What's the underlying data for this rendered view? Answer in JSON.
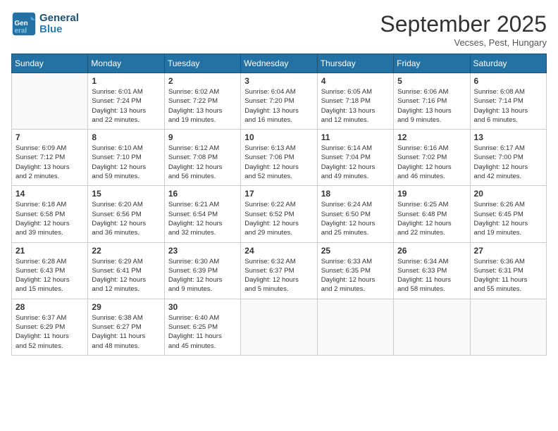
{
  "header": {
    "logo_line1": "General",
    "logo_line2": "Blue",
    "month": "September 2025",
    "location": "Vecses, Pest, Hungary"
  },
  "days_of_week": [
    "Sunday",
    "Monday",
    "Tuesday",
    "Wednesday",
    "Thursday",
    "Friday",
    "Saturday"
  ],
  "weeks": [
    [
      {
        "num": "",
        "info": ""
      },
      {
        "num": "1",
        "info": "Sunrise: 6:01 AM\nSunset: 7:24 PM\nDaylight: 13 hours\nand 22 minutes."
      },
      {
        "num": "2",
        "info": "Sunrise: 6:02 AM\nSunset: 7:22 PM\nDaylight: 13 hours\nand 19 minutes."
      },
      {
        "num": "3",
        "info": "Sunrise: 6:04 AM\nSunset: 7:20 PM\nDaylight: 13 hours\nand 16 minutes."
      },
      {
        "num": "4",
        "info": "Sunrise: 6:05 AM\nSunset: 7:18 PM\nDaylight: 13 hours\nand 12 minutes."
      },
      {
        "num": "5",
        "info": "Sunrise: 6:06 AM\nSunset: 7:16 PM\nDaylight: 13 hours\nand 9 minutes."
      },
      {
        "num": "6",
        "info": "Sunrise: 6:08 AM\nSunset: 7:14 PM\nDaylight: 13 hours\nand 6 minutes."
      }
    ],
    [
      {
        "num": "7",
        "info": "Sunrise: 6:09 AM\nSunset: 7:12 PM\nDaylight: 13 hours\nand 2 minutes."
      },
      {
        "num": "8",
        "info": "Sunrise: 6:10 AM\nSunset: 7:10 PM\nDaylight: 12 hours\nand 59 minutes."
      },
      {
        "num": "9",
        "info": "Sunrise: 6:12 AM\nSunset: 7:08 PM\nDaylight: 12 hours\nand 56 minutes."
      },
      {
        "num": "10",
        "info": "Sunrise: 6:13 AM\nSunset: 7:06 PM\nDaylight: 12 hours\nand 52 minutes."
      },
      {
        "num": "11",
        "info": "Sunrise: 6:14 AM\nSunset: 7:04 PM\nDaylight: 12 hours\nand 49 minutes."
      },
      {
        "num": "12",
        "info": "Sunrise: 6:16 AM\nSunset: 7:02 PM\nDaylight: 12 hours\nand 46 minutes."
      },
      {
        "num": "13",
        "info": "Sunrise: 6:17 AM\nSunset: 7:00 PM\nDaylight: 12 hours\nand 42 minutes."
      }
    ],
    [
      {
        "num": "14",
        "info": "Sunrise: 6:18 AM\nSunset: 6:58 PM\nDaylight: 12 hours\nand 39 minutes."
      },
      {
        "num": "15",
        "info": "Sunrise: 6:20 AM\nSunset: 6:56 PM\nDaylight: 12 hours\nand 36 minutes."
      },
      {
        "num": "16",
        "info": "Sunrise: 6:21 AM\nSunset: 6:54 PM\nDaylight: 12 hours\nand 32 minutes."
      },
      {
        "num": "17",
        "info": "Sunrise: 6:22 AM\nSunset: 6:52 PM\nDaylight: 12 hours\nand 29 minutes."
      },
      {
        "num": "18",
        "info": "Sunrise: 6:24 AM\nSunset: 6:50 PM\nDaylight: 12 hours\nand 25 minutes."
      },
      {
        "num": "19",
        "info": "Sunrise: 6:25 AM\nSunset: 6:48 PM\nDaylight: 12 hours\nand 22 minutes."
      },
      {
        "num": "20",
        "info": "Sunrise: 6:26 AM\nSunset: 6:45 PM\nDaylight: 12 hours\nand 19 minutes."
      }
    ],
    [
      {
        "num": "21",
        "info": "Sunrise: 6:28 AM\nSunset: 6:43 PM\nDaylight: 12 hours\nand 15 minutes."
      },
      {
        "num": "22",
        "info": "Sunrise: 6:29 AM\nSunset: 6:41 PM\nDaylight: 12 hours\nand 12 minutes."
      },
      {
        "num": "23",
        "info": "Sunrise: 6:30 AM\nSunset: 6:39 PM\nDaylight: 12 hours\nand 9 minutes."
      },
      {
        "num": "24",
        "info": "Sunrise: 6:32 AM\nSunset: 6:37 PM\nDaylight: 12 hours\nand 5 minutes."
      },
      {
        "num": "25",
        "info": "Sunrise: 6:33 AM\nSunset: 6:35 PM\nDaylight: 12 hours\nand 2 minutes."
      },
      {
        "num": "26",
        "info": "Sunrise: 6:34 AM\nSunset: 6:33 PM\nDaylight: 11 hours\nand 58 minutes."
      },
      {
        "num": "27",
        "info": "Sunrise: 6:36 AM\nSunset: 6:31 PM\nDaylight: 11 hours\nand 55 minutes."
      }
    ],
    [
      {
        "num": "28",
        "info": "Sunrise: 6:37 AM\nSunset: 6:29 PM\nDaylight: 11 hours\nand 52 minutes."
      },
      {
        "num": "29",
        "info": "Sunrise: 6:38 AM\nSunset: 6:27 PM\nDaylight: 11 hours\nand 48 minutes."
      },
      {
        "num": "30",
        "info": "Sunrise: 6:40 AM\nSunset: 6:25 PM\nDaylight: 11 hours\nand 45 minutes."
      },
      {
        "num": "",
        "info": ""
      },
      {
        "num": "",
        "info": ""
      },
      {
        "num": "",
        "info": ""
      },
      {
        "num": "",
        "info": ""
      }
    ]
  ]
}
